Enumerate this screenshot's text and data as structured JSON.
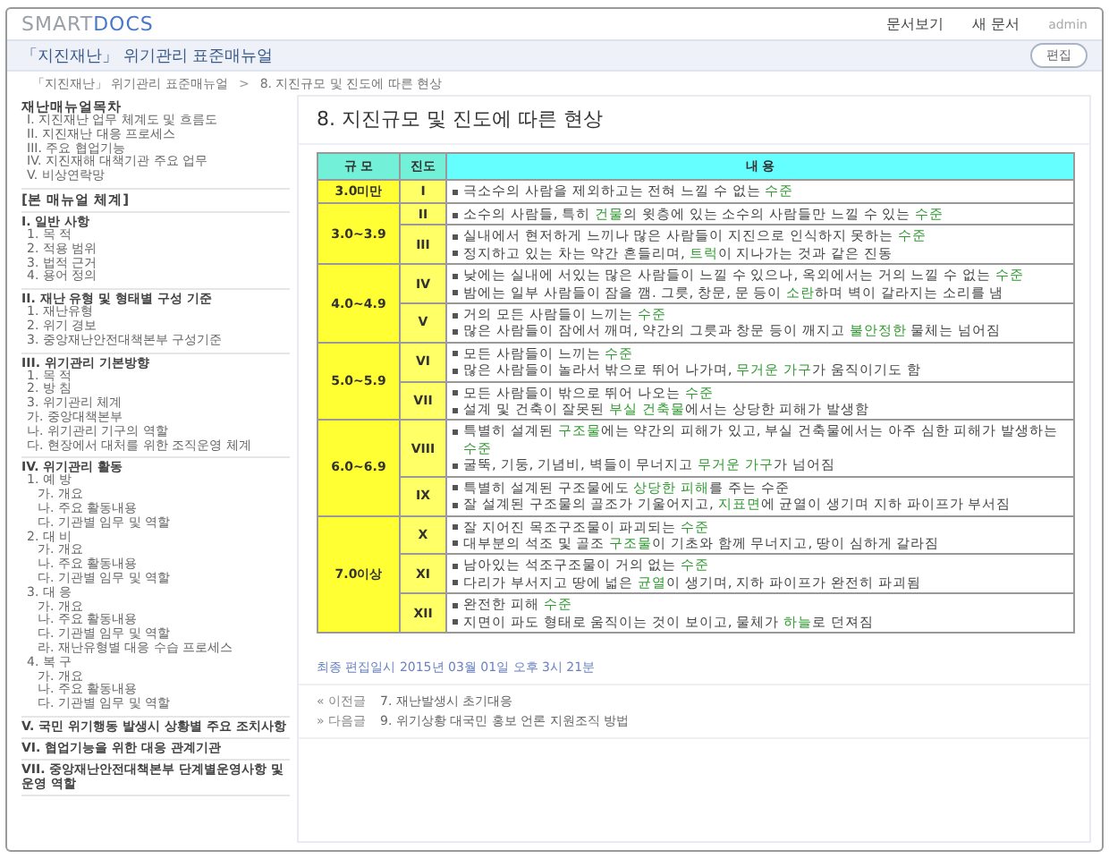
{
  "header": {
    "logo": {
      "part_1": "SMART",
      "part_2": "DOCS"
    },
    "nav": [
      "문서보기",
      "새 문서"
    ],
    "user": "admin"
  },
  "doc_title": "「지진재난」 위기관리 표준매뉴얼",
  "edit_button": "편집",
  "breadcrumb": {
    "items": [
      "「지진재난」 위기관리 표준매뉴얼",
      "8. 지진규모 및 진도에 따른 현상"
    ],
    "separator": ">"
  },
  "sidebar": {
    "title": "재난매뉴얼목차",
    "top_items": [
      "I. 지진재난 업무 체계도 및 흐름도",
      "II. 지진재난 대응 프로세스",
      "III. 주요 협업기능",
      "IV. 지진재해 대책기관 주요 업무",
      "V. 비상연락망"
    ],
    "section_title": "[본 매뉴얼 체계]",
    "chapters": [
      {
        "label": "I. 일반 사항",
        "children": [
          {
            "label": "1. 목 적"
          },
          {
            "label": "2. 적용 범위"
          },
          {
            "label": "3. 법적 근거"
          },
          {
            "label": "4. 용어 정의"
          }
        ]
      },
      {
        "label": "II. 재난 유형 및 형태별 구성 기준",
        "children": [
          {
            "label": "1. 재난유형"
          },
          {
            "label": "2. 위기 경보"
          },
          {
            "label": "3. 중앙재난안전대책본부 구성기준"
          }
        ]
      },
      {
        "label": "III. 위기관리 기본방향",
        "children": [
          {
            "label": "1. 목 적"
          },
          {
            "label": "2. 방 침"
          },
          {
            "label": "3. 위기관리 체계"
          },
          {
            "label": "가. 중앙대책본부"
          },
          {
            "label": "나. 위기관리 기구의 역할"
          },
          {
            "label": "다. 현장에서 대처를 위한 조직운영 체계"
          }
        ]
      },
      {
        "label": "IV. 위기관리 활동",
        "children": [
          {
            "label": "1. 예 방",
            "children": [
              {
                "label": "가. 개요"
              },
              {
                "label": "나. 주요 활동내용"
              },
              {
                "label": "다. 기관별 임무 및 역할"
              }
            ]
          },
          {
            "label": "2. 대 비",
            "children": [
              {
                "label": "가. 개요"
              },
              {
                "label": "나. 주요 활동내용"
              },
              {
                "label": "다. 기관별 임무 및 역할"
              }
            ]
          },
          {
            "label": "3. 대 응",
            "children": [
              {
                "label": "가. 개요"
              },
              {
                "label": "나. 주요 활동내용"
              },
              {
                "label": "다. 기관별 임무 및 역할"
              },
              {
                "label": "라. 재난유형별 대응 수습 프로세스"
              }
            ]
          },
          {
            "label": "4. 복 구",
            "children": [
              {
                "label": "가. 개요"
              },
              {
                "label": "나. 주요 활동내용"
              },
              {
                "label": "다. 기관별 임무 및 역할"
              }
            ]
          }
        ]
      },
      {
        "label": "V. 국민 위기행동 발생시 상황별 주요 조치사항"
      },
      {
        "label": "VI. 협업기능을 위한 대응 관계기관"
      },
      {
        "label": "VII. 중앙재난안전대책본부 단계별운영사항 및 운영 역할"
      }
    ]
  },
  "article": {
    "title": "8. 지진규모 및 진도에 따른 현상",
    "table": {
      "columns": [
        "규 모",
        "진도",
        "내 용"
      ],
      "groups": [
        {
          "magnitude": "3.0미만",
          "rows": [
            {
              "intensity": "I",
              "lines": [
                [
                  {
                    "t": "극소수의 사람을 제외하고는 전혀 느낄 수 없는 "
                  },
                  {
                    "t": "수준",
                    "green": true
                  }
                ]
              ]
            }
          ]
        },
        {
          "magnitude": "3.0~3.9",
          "rows": [
            {
              "intensity": "II",
              "lines": [
                [
                  {
                    "t": "소수의 사람들, 특히 "
                  },
                  {
                    "t": "건물",
                    "green": true
                  },
                  {
                    "t": "의 윗층에 있는 소수의 사람들만 느낄 수 있는 "
                  },
                  {
                    "t": "수준",
                    "green": true
                  }
                ]
              ]
            },
            {
              "intensity": "III",
              "lines": [
                [
                  {
                    "t": "실내에서 현저하게 느끼나 많은 사람들이 지진으로 인식하지 못하는 "
                  },
                  {
                    "t": "수준",
                    "green": true
                  }
                ],
                [
                  {
                    "t": "정지하고 있는 차는 약간 흔들리며, "
                  },
                  {
                    "t": "트럭",
                    "green": true
                  },
                  {
                    "t": "이 지나가는 것과 같은 진동"
                  }
                ]
              ]
            }
          ]
        },
        {
          "magnitude": "4.0~4.9",
          "rows": [
            {
              "intensity": "IV",
              "lines": [
                [
                  {
                    "t": "낮에는 실내에 서있는 많은 사람들이 느낄 수 있으나, 옥외에서는 거의 느낄 수 없는 "
                  },
                  {
                    "t": "수준",
                    "green": true
                  }
                ],
                [
                  {
                    "t": "밤에는 일부 사람들이 잠을 깸. 그릇, 창문, 문 등이 "
                  },
                  {
                    "t": "소란",
                    "green": true
                  },
                  {
                    "t": "하며 벽이 갈라지는 소리를 냄"
                  }
                ]
              ]
            },
            {
              "intensity": "V",
              "lines": [
                [
                  {
                    "t": "거의 모든 사람들이 느끼는 "
                  },
                  {
                    "t": "수준",
                    "green": true
                  }
                ],
                [
                  {
                    "t": "많은 사람들이 잠에서 깨며, 약간의 그릇과 창문 등이 깨지고 "
                  },
                  {
                    "t": "불안정한",
                    "green": true
                  },
                  {
                    "t": " 물체는 넘어짐"
                  }
                ]
              ]
            }
          ]
        },
        {
          "magnitude": "5.0~5.9",
          "rows": [
            {
              "intensity": "VI",
              "lines": [
                [
                  {
                    "t": "모든 사람들이 느끼는 "
                  },
                  {
                    "t": "수준",
                    "green": true
                  }
                ],
                [
                  {
                    "t": "많은 사람들이 놀라서 밖으로 뛰어 나가며, "
                  },
                  {
                    "t": "무거운 가구",
                    "green": true
                  },
                  {
                    "t": "가 움직이기도 함"
                  }
                ]
              ]
            },
            {
              "intensity": "VII",
              "lines": [
                [
                  {
                    "t": "모든 사람들이 밖으로 뛰어 나오는 "
                  },
                  {
                    "t": "수준",
                    "green": true
                  }
                ],
                [
                  {
                    "t": "설계 및 건축이 잘못된 "
                  },
                  {
                    "t": "부실 건축물",
                    "green": true
                  },
                  {
                    "t": "에서는 상당한 피해가 발생함"
                  }
                ]
              ]
            }
          ]
        },
        {
          "magnitude": "6.0~6.9",
          "rows": [
            {
              "intensity": "VIII",
              "lines": [
                [
                  {
                    "t": "특별히 설계된 "
                  },
                  {
                    "t": "구조물",
                    "green": true
                  },
                  {
                    "t": "에는 약간의 피해가 있고, 부실 건축물에서는 아주 심한 피해가 발생하는 "
                  },
                  {
                    "t": "수준",
                    "green": true
                  }
                ],
                [
                  {
                    "t": "굴뚝, 기둥, 기념비, 벽들이 무너지고 "
                  },
                  {
                    "t": "무거운 가구",
                    "green": true
                  },
                  {
                    "t": "가 넘어짐"
                  }
                ]
              ]
            },
            {
              "intensity": "IX",
              "lines": [
                [
                  {
                    "t": "특별히 설계된 구조물에도 "
                  },
                  {
                    "t": "상당한 피해",
                    "green": true
                  },
                  {
                    "t": "를 주는 수준"
                  }
                ],
                [
                  {
                    "t": "잘 설계된 구조물의 골조가 기울어지고, "
                  },
                  {
                    "t": "지표면",
                    "green": true
                  },
                  {
                    "t": "에 균열이 생기며 지하 파이프가 부서짐"
                  }
                ]
              ]
            }
          ]
        },
        {
          "magnitude": "7.0이상",
          "rows": [
            {
              "intensity": "X",
              "lines": [
                [
                  {
                    "t": "잘 지어진 목조구조물이 파괴되는 "
                  },
                  {
                    "t": "수준",
                    "green": true
                  }
                ],
                [
                  {
                    "t": "대부분의 석조 및 골조 "
                  },
                  {
                    "t": "구조물",
                    "green": true
                  },
                  {
                    "t": "이 기초와 함께 무너지고, 땅이 심하게 갈라짐"
                  }
                ]
              ]
            },
            {
              "intensity": "XI",
              "lines": [
                [
                  {
                    "t": "남아있는 석조구조물이 거의 없는 "
                  },
                  {
                    "t": "수준",
                    "green": true
                  }
                ],
                [
                  {
                    "t": "다리가 부서지고 땅에 넓은 "
                  },
                  {
                    "t": "균열",
                    "green": true
                  },
                  {
                    "t": "이 생기며, 지하 파이프가 완전히 파괴됨"
                  }
                ]
              ]
            },
            {
              "intensity": "XII",
              "lines": [
                [
                  {
                    "t": "완전한 피해 "
                  },
                  {
                    "t": "수준",
                    "green": true
                  }
                ],
                [
                  {
                    "t": "지면이 파도 형태로 움직이는 것이 보이고, 물체가 "
                  },
                  {
                    "t": "하늘",
                    "green": true
                  },
                  {
                    "t": "로 던져짐"
                  }
                ]
              ]
            }
          ]
        }
      ]
    },
    "last_edited": "최종 편집일시 2015년 03월 01일 오후 3시 21분",
    "pager": [
      {
        "label": "« 이전글",
        "title": "7. 재난발생시 초기대응"
      },
      {
        "label": "» 다음글",
        "title": "9. 위기상황 대국민 홍보 언론 지원조직 방법"
      }
    ]
  }
}
